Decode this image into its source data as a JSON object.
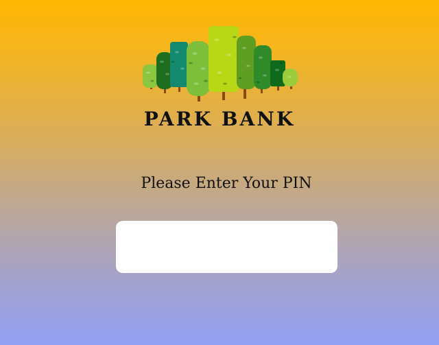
{
  "app": {
    "brand_name": "PARK BANK",
    "logo_icon": "forest-trees-icon"
  },
  "pin_entry": {
    "prompt": "Please Enter Your PIN",
    "value": "",
    "placeholder": ""
  },
  "colors": {
    "background_top": "#ffb700",
    "background_bottom": "#929ff2",
    "input_background": "#ffffff",
    "text": "#111111"
  }
}
